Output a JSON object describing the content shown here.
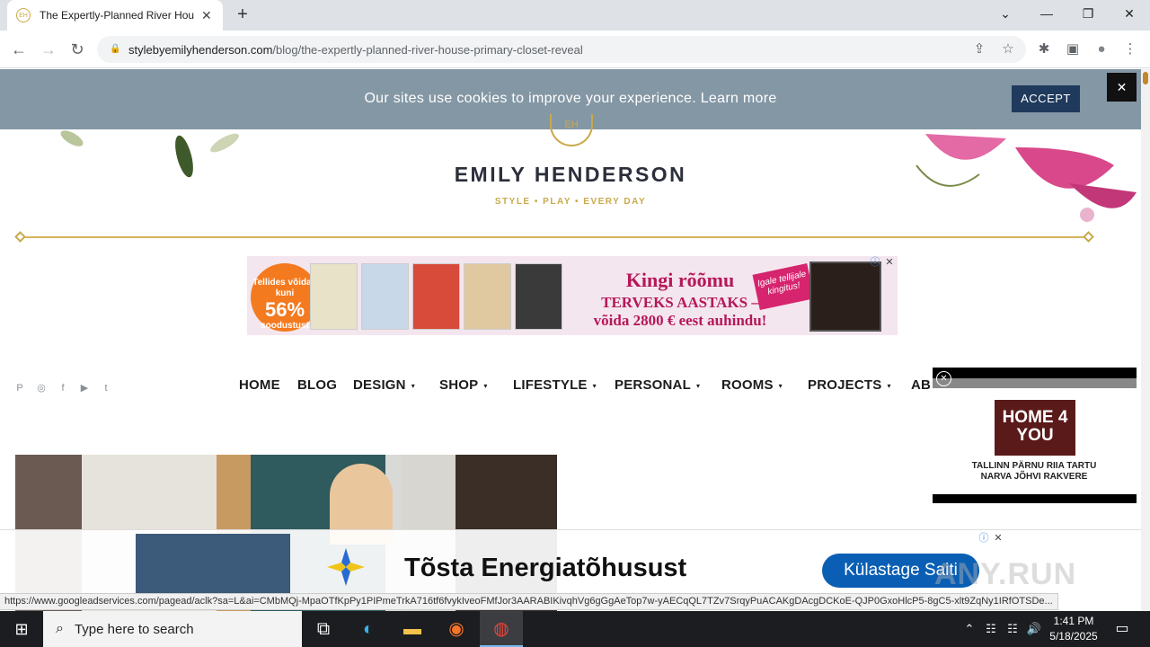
{
  "browser": {
    "tab_title": "The Expertly-Planned River Hou",
    "url_host": "stylebyemilyhenderson.com",
    "url_path": "/blog/the-expertly-planned-river-house-primary-closet-reveal",
    "favicon_text": "EH",
    "tab_close": "✕",
    "new_tab": "+",
    "win_minimize": "—",
    "win_restore": "❐",
    "win_close": "✕",
    "tab_search": "⌄"
  },
  "toolbar": {
    "back": "←",
    "forward": "→",
    "reload": "↻",
    "lock": "🔒",
    "share": "⇪",
    "star": "☆",
    "extensions": "✱",
    "sidepanel": "▣",
    "profile": "●",
    "menu": "⋮"
  },
  "cookie": {
    "message": "Our sites use cookies to improve your experience.",
    "learn_more": "Learn more",
    "accept": "ACCEPT",
    "close": "✕"
  },
  "site": {
    "monogram": "EH",
    "brand": "EMILY HENDERSON",
    "tagline": "STYLE  •  PLAY  •  EVERY DAY"
  },
  "ad_top": {
    "badge_top": "Tellides võidad kuni",
    "badge_big": "56%",
    "badge_bottom": "soodustust",
    "title": "Kingi rõõmu",
    "subtitle_1": "TERVEKS AASTAKS –",
    "subtitle_2": "võida 2800 € eest auhindu!",
    "tag": "Igale tellijale kingitus!",
    "info": "ⓘ",
    "close": "✕"
  },
  "nav": {
    "items": [
      "HOME",
      "BLOG",
      "DESIGN",
      "SHOP",
      "LIFESTYLE",
      "PERSONAL",
      "ROOMS",
      "PROJECTS",
      "AB"
    ],
    "caret": "▾",
    "social": [
      "P",
      "◎",
      "f",
      "▶",
      "t"
    ]
  },
  "ad_side": {
    "close": "✕",
    "logo": "HOME 4 YOU",
    "cities": "TALLINN PÄRNU RIIA TARTU NARVA JÕHVI RAKVERE"
  },
  "ad_bottom": {
    "text": "Tõsta Energiatõhusust",
    "button": "Külastage Saiti",
    "info": "ⓘ",
    "close": "✕"
  },
  "status_url": "https://www.googleadservices.com/pagead/aclk?sa=L&ai=CMbMQj-MpaOTfKpPy1PIPmeTrkA716tf6fvykIveoFMfJor3AARABIKivqhVg6gGgAeTop7w-yAECqQL7TZv7SrqyPuACAKgDAcgDCKoE-QJP0GxoHlcP5-8gC5-xlt9ZqNy1IRfOTSDe...",
  "watermark": "ANY.RUN",
  "taskbar": {
    "search_placeholder": "Type here to search",
    "time": "1:41 PM",
    "date": "5/18/2025",
    "search_icon": "⌕",
    "windows_icon": "⊞",
    "taskview_icon": "⧉",
    "edge_icon": "◐",
    "files_icon": "▬",
    "firefox_icon": "◉",
    "chrome_icon": "◍",
    "tray_arrow": "⌃",
    "tray_network": "☷",
    "tray_volume": "🔊",
    "notifications": "▭"
  }
}
